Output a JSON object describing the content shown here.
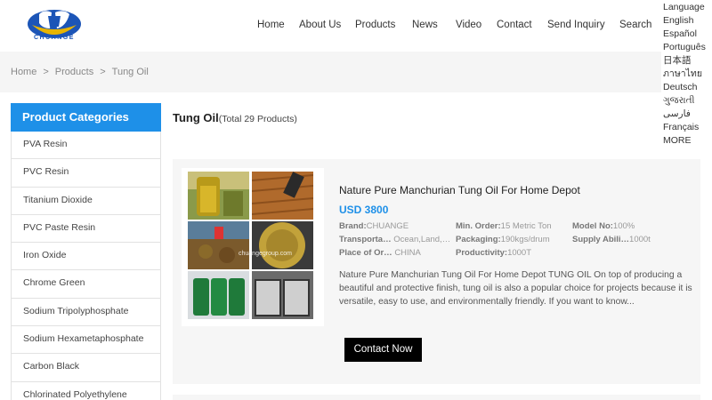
{
  "header": {
    "logo_text": "CHUANGE",
    "nav": [
      "Home",
      "About Us",
      "Products",
      "News",
      "Video",
      "Contact",
      "Send Inquiry",
      "Search"
    ]
  },
  "language": {
    "label": "Language",
    "options": [
      "English",
      "Español",
      "Português",
      "日本語",
      "ภาษาไทย",
      "Deutsch",
      "ગુજરાતી",
      "فارسی",
      "Français"
    ],
    "more": "MORE"
  },
  "breadcrumb": [
    "Home",
    "Products",
    "Tung Oil"
  ],
  "breadcrumb_sep": ">",
  "sidebar": {
    "title": "Product Categories",
    "items": [
      "PVA Resin",
      "PVC Resin",
      "Titanium Dioxide",
      "PVC Paste Resin",
      "Iron Oxide",
      "Chrome Green",
      "Sodium Tripolyphosphate",
      "Sodium Hexametaphosphate",
      "Carbon Black",
      "Chlorinated Polyethylene"
    ]
  },
  "main": {
    "title": "Tung Oil",
    "count": "(Total 29 Products)"
  },
  "product": {
    "title": "Nature Pure Manchurian Tung Oil For Home Depot",
    "price": "USD 3800",
    "watermark": "chuangegroup.com",
    "attrs": [
      {
        "key": "Brand:",
        "value": "CHUANGE"
      },
      {
        "key": "Min. Order:",
        "value": "15 Metric Ton"
      },
      {
        "key": "Model No:",
        "value": "100%"
      },
      {
        "key": "Transporta…",
        "value": "Ocean,Land,…"
      },
      {
        "key": "Packaging:",
        "value": "190kgs/drum"
      },
      {
        "key": "Supply Abili…",
        "value": "1000t"
      },
      {
        "key": "Place of Or…",
        "value": "CHINA"
      },
      {
        "key": "Productivity:",
        "value": "1000T"
      }
    ],
    "description": "Nature Pure Manchurian Tung Oil For Home Depot TUNG OIL On top of producing a beautiful and protective finish, tung oil is also a popular choice for projects because it is versatile, easy to use, and environmentally friendly. If you want to know...",
    "button": "Contact Now"
  },
  "colors": {
    "accent": "#1e90e8",
    "brand": "#1c55b7",
    "button": "#000000"
  }
}
